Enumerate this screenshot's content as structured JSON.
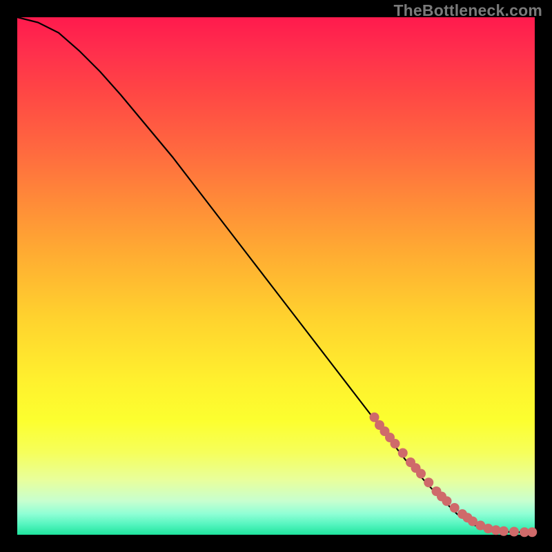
{
  "watermark": "TheBottleneck.com",
  "chart_data": {
    "type": "line",
    "title": "",
    "xlabel": "",
    "ylabel": "",
    "xlim": [
      0,
      100
    ],
    "ylim": [
      0,
      100
    ],
    "grid": false,
    "legend": false,
    "series": [
      {
        "name": "curve",
        "style": "line",
        "color": "#000000",
        "x": [
          0,
          4,
          8,
          12,
          16,
          20,
          25,
          30,
          35,
          40,
          45,
          50,
          55,
          60,
          65,
          70,
          75,
          80,
          85,
          88,
          90,
          92,
          94,
          96,
          98,
          100
        ],
        "y": [
          100,
          99,
          97,
          93.5,
          89.5,
          85,
          79,
          73,
          66.5,
          60,
          53.5,
          47,
          40.5,
          34,
          27.5,
          21,
          14.5,
          9,
          4,
          2,
          1.2,
          0.8,
          0.6,
          0.5,
          0.5,
          0.5
        ]
      },
      {
        "name": "markers",
        "style": "scatter",
        "color": "#cf6a6a",
        "x": [
          69,
          70,
          71,
          72,
          73,
          74.5,
          76,
          77,
          78,
          79.5,
          81,
          82,
          83,
          84.5,
          86,
          87,
          88,
          89.5,
          91,
          92.5,
          94,
          96,
          98,
          99.5
        ],
        "y": [
          22.7,
          21.2,
          20.0,
          18.8,
          17.6,
          15.8,
          14.0,
          12.9,
          11.8,
          10.1,
          8.4,
          7.4,
          6.5,
          5.2,
          4.0,
          3.3,
          2.6,
          1.8,
          1.2,
          0.9,
          0.7,
          0.6,
          0.5,
          0.5
        ]
      }
    ]
  }
}
